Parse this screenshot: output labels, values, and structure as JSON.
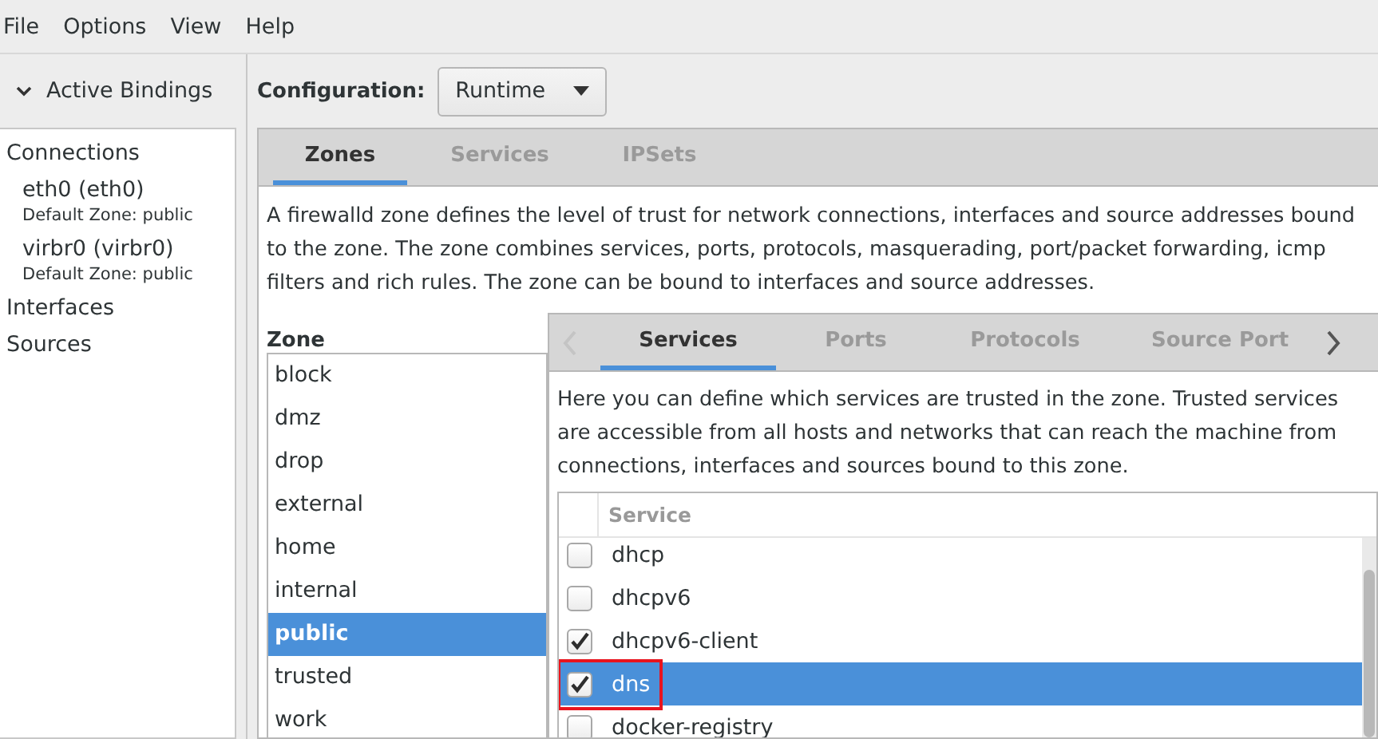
{
  "menu": [
    "File",
    "Options",
    "View",
    "Help"
  ],
  "bindings": {
    "title": "Active Bindings",
    "expanded": true,
    "sections": [
      {
        "label": "Connections",
        "children": [
          {
            "name": "eth0 (eth0)",
            "detail": "Default Zone: public"
          },
          {
            "name": "virbr0 (virbr0)",
            "detail": "Default Zone: public"
          }
        ]
      },
      {
        "label": "Interfaces"
      },
      {
        "label": "Sources"
      }
    ]
  },
  "configuration": {
    "label": "Configuration:",
    "value": "Runtime"
  },
  "tabs": [
    {
      "label": "Zones",
      "selected": true
    },
    {
      "label": "Services",
      "selected": false
    },
    {
      "label": "IPSets",
      "selected": false
    }
  ],
  "zone_description": "A firewalld zone defines the level of trust for network connections, interfaces and source addresses bound to the zone. The zone combines services, ports, protocols, masquerading, port/packet forwarding, icmp filters and rich rules. The zone can be bound to interfaces and source addresses.",
  "zones": {
    "label": "Zone",
    "items": [
      {
        "name": "block",
        "selected": false
      },
      {
        "name": "dmz",
        "selected": false
      },
      {
        "name": "drop",
        "selected": false
      },
      {
        "name": "external",
        "selected": false
      },
      {
        "name": "home",
        "selected": false
      },
      {
        "name": "internal",
        "selected": false
      },
      {
        "name": "public",
        "selected": true
      },
      {
        "name": "trusted",
        "selected": false
      },
      {
        "name": "work",
        "selected": false
      }
    ]
  },
  "zone_tabs": [
    {
      "label": "Services",
      "selected": true
    },
    {
      "label": "Ports",
      "selected": false
    },
    {
      "label": "Protocols",
      "selected": false
    },
    {
      "label": "Source Port",
      "selected": false
    }
  ],
  "services_description": "Here you can define which services are trusted in the zone. Trusted services are accessible from all hosts and networks that can reach the machine from connections, interfaces and sources bound to this zone.",
  "services_table": {
    "column": "Service",
    "rows": [
      {
        "name": "dhcp",
        "checked": false,
        "selected": false,
        "highlighted": false
      },
      {
        "name": "dhcpv6",
        "checked": false,
        "selected": false,
        "highlighted": false
      },
      {
        "name": "dhcpv6-client",
        "checked": true,
        "selected": false,
        "highlighted": false
      },
      {
        "name": "dns",
        "checked": true,
        "selected": true,
        "highlighted": true
      },
      {
        "name": "docker-registry",
        "checked": false,
        "selected": false,
        "highlighted": false
      }
    ]
  }
}
